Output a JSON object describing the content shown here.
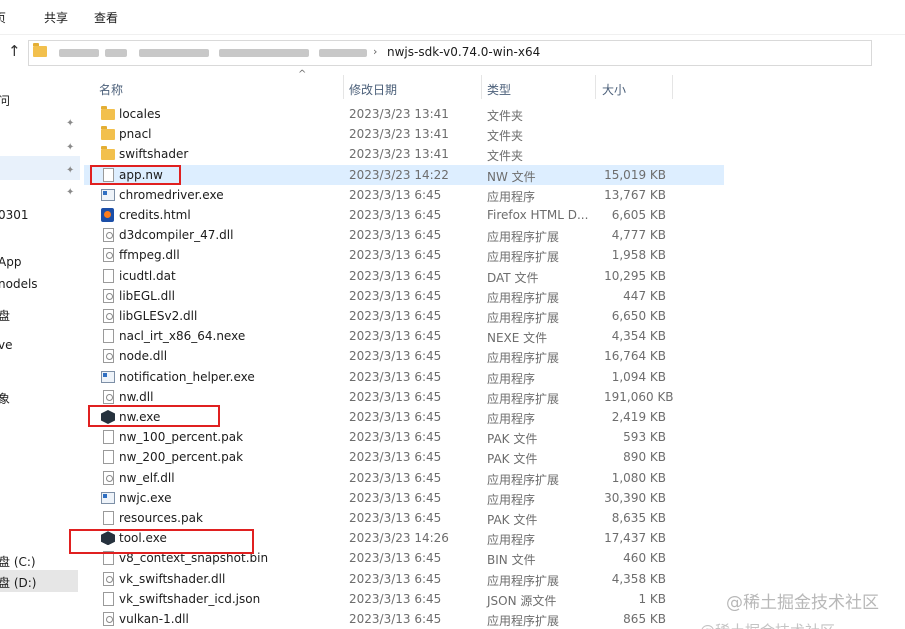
{
  "ribbon": {
    "tabs": [
      {
        "label": "页"
      },
      {
        "label": "共享"
      },
      {
        "label": "查看"
      }
    ]
  },
  "address": {
    "current": "nwjs-sdk-v0.74.0-win-x64",
    "separator": "›"
  },
  "nav": {
    "items": [
      {
        "label": "问"
      },
      {
        "label": "0301"
      },
      {
        "label": "App"
      },
      {
        "label": "nodels"
      },
      {
        "label": "盘"
      },
      {
        "label": "ve"
      },
      {
        "label": "象"
      },
      {
        "label": "盘 (C:)"
      },
      {
        "label": "盘 (D:)"
      }
    ]
  },
  "columns": {
    "name": "名称",
    "date": "修改日期",
    "type": "类型",
    "size": "大小"
  },
  "files": [
    {
      "name": "locales",
      "date": "2023/3/23 13:41",
      "type": "文件夹",
      "size": "",
      "icon": "folder-icon"
    },
    {
      "name": "pnacl",
      "date": "2023/3/23 13:41",
      "type": "文件夹",
      "size": "",
      "icon": "folder-icon"
    },
    {
      "name": "swiftshader",
      "date": "2023/3/23 13:41",
      "type": "文件夹",
      "size": "",
      "icon": "folder-icon"
    },
    {
      "name": "app.nw",
      "date": "2023/3/23 14:22",
      "type": "NW 文件",
      "size": "15,019 KB",
      "icon": "file-icon"
    },
    {
      "name": "chromedriver.exe",
      "date": "2023/3/13 6:45",
      "type": "应用程序",
      "size": "13,767 KB",
      "icon": "exe-icon"
    },
    {
      "name": "credits.html",
      "date": "2023/3/13 6:45",
      "type": "Firefox HTML D...",
      "size": "6,605 KB",
      "icon": "firefox-html-icon"
    },
    {
      "name": "d3dcompiler_47.dll",
      "date": "2023/3/13 6:45",
      "type": "应用程序扩展",
      "size": "4,777 KB",
      "icon": "dll-icon"
    },
    {
      "name": "ffmpeg.dll",
      "date": "2023/3/13 6:45",
      "type": "应用程序扩展",
      "size": "1,958 KB",
      "icon": "dll-icon"
    },
    {
      "name": "icudtl.dat",
      "date": "2023/3/13 6:45",
      "type": "DAT 文件",
      "size": "10,295 KB",
      "icon": "file-icon"
    },
    {
      "name": "libEGL.dll",
      "date": "2023/3/13 6:45",
      "type": "应用程序扩展",
      "size": "447 KB",
      "icon": "dll-icon"
    },
    {
      "name": "libGLESv2.dll",
      "date": "2023/3/13 6:45",
      "type": "应用程序扩展",
      "size": "6,650 KB",
      "icon": "dll-icon"
    },
    {
      "name": "nacl_irt_x86_64.nexe",
      "date": "2023/3/13 6:45",
      "type": "NEXE 文件",
      "size": "4,354 KB",
      "icon": "file-icon"
    },
    {
      "name": "node.dll",
      "date": "2023/3/13 6:45",
      "type": "应用程序扩展",
      "size": "16,764 KB",
      "icon": "dll-icon"
    },
    {
      "name": "notification_helper.exe",
      "date": "2023/3/13 6:45",
      "type": "应用程序",
      "size": "1,094 KB",
      "icon": "exe-icon"
    },
    {
      "name": "nw.dll",
      "date": "2023/3/13 6:45",
      "type": "应用程序扩展",
      "size": "191,060 KB",
      "icon": "dll-icon"
    },
    {
      "name": "nw.exe",
      "date": "2023/3/13 6:45",
      "type": "应用程序",
      "size": "2,419 KB",
      "icon": "nw-app-icon"
    },
    {
      "name": "nw_100_percent.pak",
      "date": "2023/3/13 6:45",
      "type": "PAK 文件",
      "size": "593 KB",
      "icon": "file-icon"
    },
    {
      "name": "nw_200_percent.pak",
      "date": "2023/3/13 6:45",
      "type": "PAK 文件",
      "size": "890 KB",
      "icon": "file-icon"
    },
    {
      "name": "nw_elf.dll",
      "date": "2023/3/13 6:45",
      "type": "应用程序扩展",
      "size": "1,080 KB",
      "icon": "dll-icon"
    },
    {
      "name": "nwjc.exe",
      "date": "2023/3/13 6:45",
      "type": "应用程序",
      "size": "30,390 KB",
      "icon": "exe-icon"
    },
    {
      "name": "resources.pak",
      "date": "2023/3/13 6:45",
      "type": "PAK 文件",
      "size": "8,635 KB",
      "icon": "file-icon"
    },
    {
      "name": "tool.exe",
      "date": "2023/3/23 14:26",
      "type": "应用程序",
      "size": "17,437 KB",
      "icon": "nw-app-icon"
    },
    {
      "name": "v8_context_snapshot.bin",
      "date": "2023/3/13 6:45",
      "type": "BIN 文件",
      "size": "460 KB",
      "icon": "file-icon"
    },
    {
      "name": "vk_swiftshader.dll",
      "date": "2023/3/13 6:45",
      "type": "应用程序扩展",
      "size": "4,358 KB",
      "icon": "dll-icon"
    },
    {
      "name": "vk_swiftshader_icd.json",
      "date": "2023/3/13 6:45",
      "type": "JSON 源文件",
      "size": "1 KB",
      "icon": "file-icon"
    },
    {
      "name": "vulkan-1.dll",
      "date": "2023/3/13 6:45",
      "type": "应用程序扩展",
      "size": "865 KB",
      "icon": "dll-icon"
    }
  ],
  "highlight_color": "#e02020",
  "watermark": "@稀土掘金技术社区"
}
